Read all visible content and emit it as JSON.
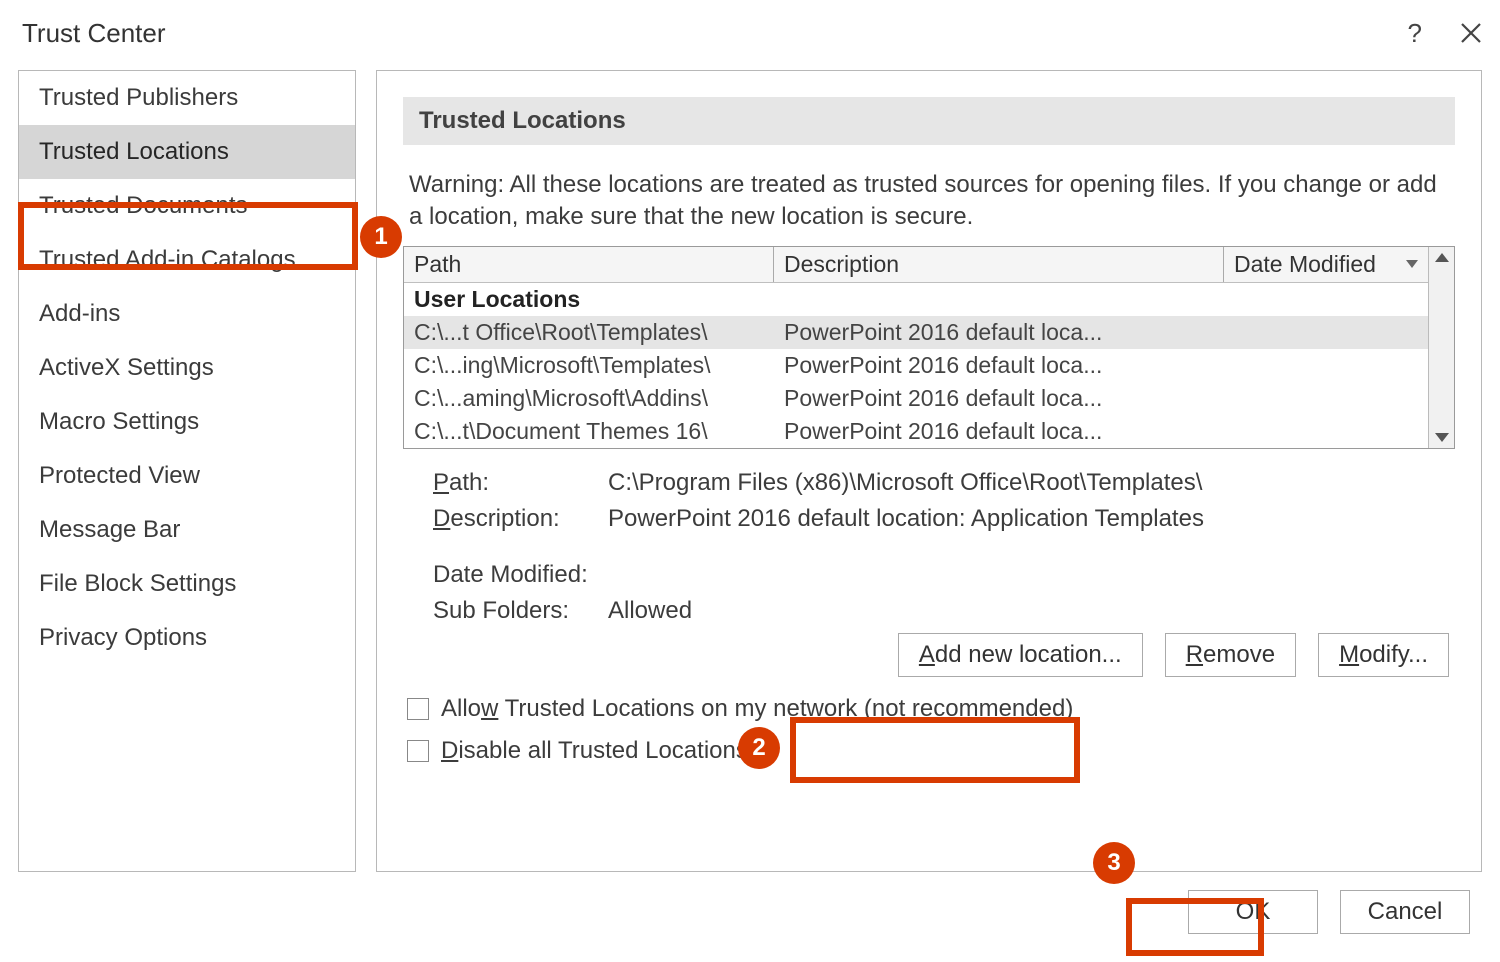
{
  "title": "Trust Center",
  "help_tooltip": "?",
  "sidebar": {
    "items": [
      "Trusted Publishers",
      "Trusted Locations",
      "Trusted Documents",
      "Trusted Add-in Catalogs",
      "Add-ins",
      "ActiveX Settings",
      "Macro Settings",
      "Protected View",
      "Message Bar",
      "File Block Settings",
      "Privacy Options"
    ],
    "selected_index": 1
  },
  "main": {
    "section_title": "Trusted Locations",
    "warning": "Warning: All these locations are treated as trusted sources for opening files.  If you change or add a location, make sure that the new location is secure.",
    "columns": {
      "path": "Path",
      "desc": "Description",
      "date": "Date Modified"
    },
    "group_label": "User Locations",
    "rows": [
      {
        "path": "C:\\...t Office\\Root\\Templates\\",
        "desc": "PowerPoint 2016 default loca...",
        "date": ""
      },
      {
        "path": "C:\\...ing\\Microsoft\\Templates\\",
        "desc": "PowerPoint 2016 default loca...",
        "date": ""
      },
      {
        "path": "C:\\...aming\\Microsoft\\Addins\\",
        "desc": "PowerPoint 2016 default loca...",
        "date": ""
      },
      {
        "path": "C:\\...t\\Document Themes 16\\",
        "desc": "PowerPoint 2016 default loca...",
        "date": ""
      }
    ],
    "selected_row": 0,
    "details": {
      "labels": {
        "path": "Path:",
        "desc": "Description:",
        "date": "Date Modified:",
        "sub": "Sub Folders:"
      },
      "path": "C:\\Program Files (x86)\\Microsoft Office\\Root\\Templates\\",
      "description": "PowerPoint 2016 default location: Application Templates",
      "date_modified": "",
      "sub_folders": "Allowed"
    },
    "buttons": {
      "add": "Add new location...",
      "remove": "Remove",
      "modify": "Modify..."
    },
    "checkboxes": {
      "allow_network": "Allow Trusted Locations on my network (not recommended)",
      "disable_all": "Disable all Trusted Locations"
    }
  },
  "footer": {
    "ok": "OK",
    "cancel": "Cancel"
  },
  "callouts": {
    "1": "1",
    "2": "2",
    "3": "3"
  }
}
